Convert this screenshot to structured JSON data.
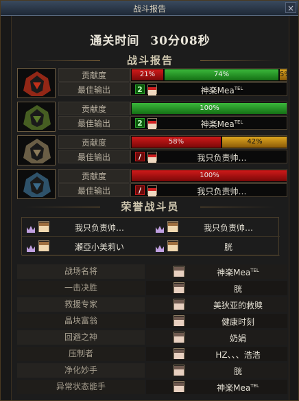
{
  "window": {
    "title": "战斗报告",
    "close_icon": "×"
  },
  "clear_time": {
    "label": "通关时间",
    "value": "30分08秒"
  },
  "sections": {
    "report": "战斗报告",
    "honor": "荣誉战斗员"
  },
  "row_labels": {
    "contribution": "贡献度",
    "best_output": "最佳输出"
  },
  "players": [
    {
      "portrait_color": "#c0301a",
      "contribution": [
        {
          "pct": 21,
          "label": "21%",
          "color": "red"
        },
        {
          "pct": 74,
          "label": "74%",
          "color": "green"
        },
        {
          "pct": 5,
          "label": "5%",
          "color": "gold"
        }
      ],
      "best_icon": "2",
      "best_icon_color": "green",
      "best_name": "神楽Mea",
      "best_sup": "TEL"
    },
    {
      "portrait_color": "#5a7a2a",
      "contribution": [
        {
          "pct": 100,
          "label": "100%",
          "color": "green"
        }
      ],
      "best_icon": "2",
      "best_icon_color": "green",
      "best_name": "神楽Mea",
      "best_sup": "TEL"
    },
    {
      "portrait_color": "#8a7a5a",
      "contribution": [
        {
          "pct": 58,
          "label": "58%",
          "color": "red"
        },
        {
          "pct": 42,
          "label": "42%",
          "color": "gold"
        }
      ],
      "best_icon": "/",
      "best_icon_color": "red",
      "best_name": "我只负责帅…",
      "best_sup": ""
    },
    {
      "portrait_color": "#3a6a8a",
      "contribution": [
        {
          "pct": 100,
          "label": "100%",
          "color": "red"
        }
      ],
      "best_icon": "/",
      "best_icon_color": "red",
      "best_name": "我只负责帅…",
      "best_sup": ""
    }
  ],
  "honor_members": [
    {
      "name": "我只负责帅…"
    },
    {
      "name": "我只负责帅…"
    },
    {
      "name": "瀬亞小美莉い"
    },
    {
      "name": "胱"
    }
  ],
  "awards": [
    {
      "title": "战场名将",
      "name": "神楽Mea",
      "sup": "TEL"
    },
    {
      "title": "一击决胜",
      "name": "胱",
      "sup": ""
    },
    {
      "title": "救援专家",
      "name": "美狄亚的救赎",
      "sup": ""
    },
    {
      "title": "晶块富翁",
      "name": "健康时刻",
      "sup": ""
    },
    {
      "title": "回避之神",
      "name": "奶娟",
      "sup": ""
    },
    {
      "title": "压制者",
      "name": "HZ、、、浩浩",
      "sup": ""
    },
    {
      "title": "净化妙手",
      "name": "胱",
      "sup": ""
    },
    {
      "title": "异常状态能手",
      "name": "神楽Mea",
      "sup": "TEL"
    }
  ]
}
